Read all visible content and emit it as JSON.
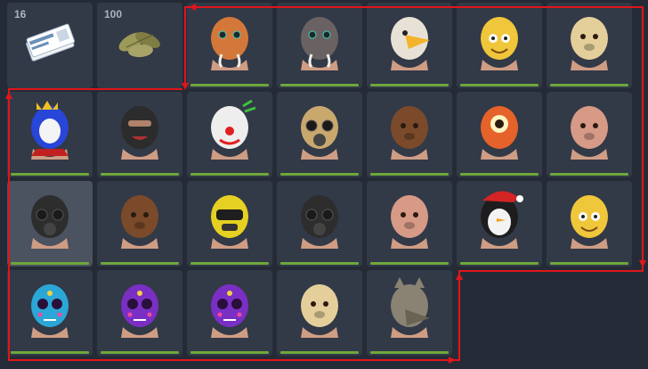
{
  "inventory": {
    "slots": [
      {
        "icon": "ticket-stack-icon",
        "qty": "16",
        "condition": null,
        "color": "#6a8fb8",
        "highlight": false
      },
      {
        "icon": "leaves-icon",
        "qty": "100",
        "condition": null,
        "color": "#8a8a50",
        "highlight": false
      },
      {
        "icon": "octopus-mask-icon",
        "qty": "",
        "condition": 100,
        "color": "#d3783a",
        "highlight": false
      },
      {
        "icon": "boar-mask-icon",
        "qty": "",
        "condition": 100,
        "color": "#6a6262",
        "highlight": false
      },
      {
        "icon": "eagle-mask-icon",
        "qty": "",
        "condition": 100,
        "color": "#e8e2d6",
        "highlight": false
      },
      {
        "icon": "pineapple-mask-icon",
        "qty": "",
        "condition": 100,
        "color": "#f0c63a",
        "highlight": false
      },
      {
        "icon": "skull-mask-icon",
        "qty": "",
        "condition": 100,
        "color": "#e4cf9a",
        "highlight": false
      },
      {
        "icon": "crown-joker-mask-icon",
        "qty": "",
        "condition": 100,
        "color": "#2846d8",
        "highlight": false
      },
      {
        "icon": "balaclava-mask-icon",
        "qty": "",
        "condition": 100,
        "color": "#2c2c2c",
        "highlight": false
      },
      {
        "icon": "clown-mask-icon",
        "qty": "",
        "condition": 100,
        "color": "#eeeeee",
        "highlight": false
      },
      {
        "icon": "respirator-mask-icon",
        "qty": "",
        "condition": 100,
        "color": "#c9a86e",
        "highlight": false
      },
      {
        "icon": "bear-mask-icon",
        "qty": "",
        "condition": 100,
        "color": "#7a4a2a",
        "highlight": false
      },
      {
        "icon": "cyclops-mask-icon",
        "qty": "",
        "condition": 100,
        "color": "#e5622a",
        "highlight": false
      },
      {
        "icon": "pig-mask-icon",
        "qty": "",
        "condition": 100,
        "color": "#d79a86",
        "highlight": false
      },
      {
        "icon": "gas-mask-icon",
        "qty": "",
        "condition": 100,
        "color": "#2d2d2d",
        "highlight": true
      },
      {
        "icon": "bear-mask-icon",
        "qty": "",
        "condition": 100,
        "color": "#7a4a2a",
        "highlight": false
      },
      {
        "icon": "hazmat-mask-icon",
        "qty": "",
        "condition": 100,
        "color": "#e6d021",
        "highlight": false
      },
      {
        "icon": "gas-mask-icon",
        "qty": "",
        "condition": 100,
        "color": "#2d2d2d",
        "highlight": false
      },
      {
        "icon": "pig-mask-icon",
        "qty": "",
        "condition": 100,
        "color": "#d79a86",
        "highlight": false
      },
      {
        "icon": "penguin-mask-icon",
        "qty": "",
        "condition": 100,
        "color": "#1d1d1d",
        "highlight": false
      },
      {
        "icon": "pineapple-mask-icon",
        "qty": "",
        "condition": 100,
        "color": "#f0c63a",
        "highlight": false
      },
      {
        "icon": "sugar-skull-mask-icon",
        "qty": "",
        "condition": 100,
        "color": "#2aa7d6",
        "highlight": false
      },
      {
        "icon": "sugar-skull-mask-icon",
        "qty": "",
        "condition": 100,
        "color": "#7a2fc4",
        "highlight": false
      },
      {
        "icon": "sugar-skull-mask-icon",
        "qty": "",
        "condition": 100,
        "color": "#7a2fc4",
        "highlight": false
      },
      {
        "icon": "skull-mask-icon",
        "qty": "",
        "condition": 100,
        "color": "#e4cf9a",
        "highlight": false
      },
      {
        "icon": "wolf-mask-icon",
        "qty": "",
        "condition": 100,
        "color": "#8a8272",
        "highlight": false
      },
      {
        "icon": "",
        "qty": "",
        "condition": null,
        "color": "",
        "highlight": false,
        "empty": true
      },
      {
        "icon": "",
        "qty": "",
        "condition": null,
        "color": "",
        "highlight": false,
        "empty": true
      }
    ],
    "route_color": "#e0151b"
  }
}
